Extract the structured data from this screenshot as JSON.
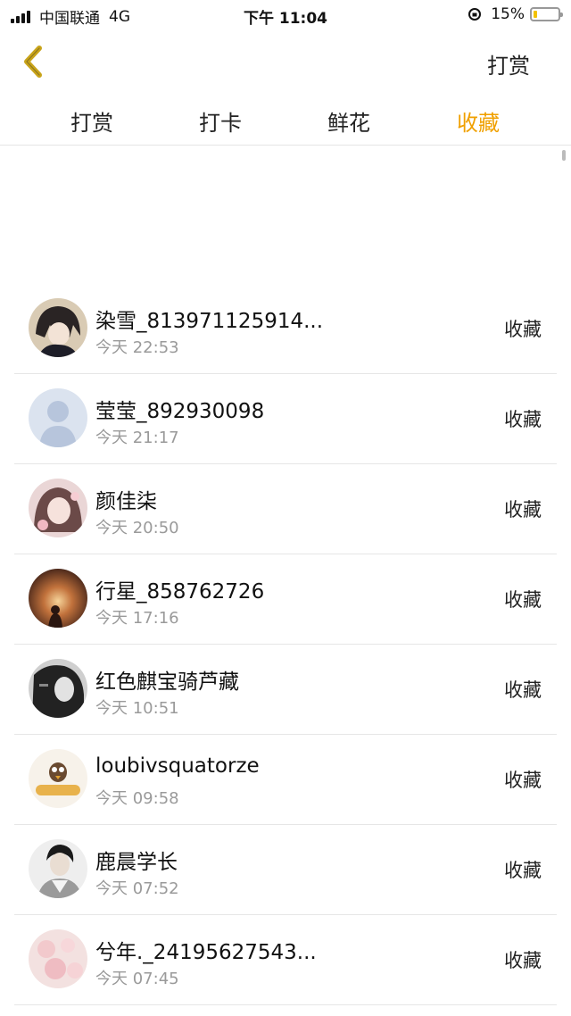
{
  "status": {
    "carrier": "中国联通",
    "network": "4G",
    "time": "下午 11:04",
    "battery": "15%",
    "battery_level": 0.15
  },
  "nav": {
    "back_icon": "chevron-left-icon",
    "action": "打赏"
  },
  "tabs": [
    {
      "label": "打赏",
      "active": false
    },
    {
      "label": "打卡",
      "active": false
    },
    {
      "label": "鲜花",
      "active": false
    },
    {
      "label": "收藏",
      "active": true
    }
  ],
  "colors": {
    "accent": "#f0a000",
    "back_icon": "#c9a41a"
  },
  "records": [
    {
      "name": "染雪_813971125914...",
      "time": "今天 22:53",
      "action": "收藏"
    },
    {
      "name": "莹莹_892930098",
      "time": "今天 21:17",
      "action": "收藏"
    },
    {
      "name": "颜佳柒",
      "time": "今天 20:50",
      "action": "收藏"
    },
    {
      "name": "行星_858762726",
      "time": "今天 17:16",
      "action": "收藏"
    },
    {
      "name": "红色麒宝骑芦藏",
      "time": "今天 10:51",
      "action": "收藏"
    },
    {
      "name": "loubivsquatorze",
      "time": "今天 09:58",
      "action": "收藏"
    },
    {
      "name": "鹿晨学长",
      "time": "今天 07:52",
      "action": "收藏"
    },
    {
      "name": "兮年._24195627543...",
      "time": "今天 07:45",
      "action": "收藏"
    }
  ]
}
